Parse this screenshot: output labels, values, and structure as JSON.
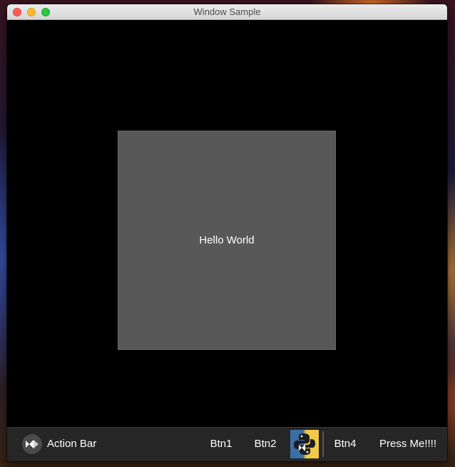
{
  "window": {
    "title": "Window Sample"
  },
  "content": {
    "label": "Hello World"
  },
  "action_bar": {
    "app_icon": "kivy-logo-icon",
    "title": "Action Bar",
    "buttons": [
      {
        "label": "Btn1"
      },
      {
        "label": "Btn2"
      },
      {
        "icon": "python-logo-icon"
      },
      {
        "label": "Btn4"
      },
      {
        "label": "Press Me!!!!"
      }
    ]
  },
  "colors": {
    "box": "#585858",
    "action_bar": "#262626",
    "window_bg": "#000000"
  }
}
